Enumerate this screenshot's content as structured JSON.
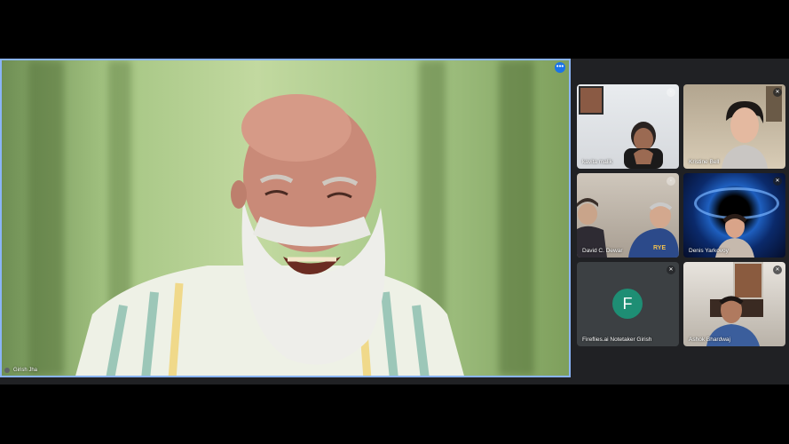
{
  "main_speaker": {
    "name": "Girish Jha",
    "more_icon": "more-options-icon"
  },
  "participants": [
    {
      "name": "kavita malik",
      "muted": false
    },
    {
      "name": "Kristine Bell",
      "muted": true
    },
    {
      "name": "David C. Dewar",
      "muted": false
    },
    {
      "name": "Denis Yarkovoy",
      "muted": true
    },
    {
      "name": "Fireflies.ai Notetaker Girish",
      "muted": true,
      "avatar_letter": "F",
      "avatar_color": "#1e8e74"
    },
    {
      "name": "Ashok Bhardwaj",
      "muted": true
    }
  ],
  "colors": {
    "meet_bg": "#202124",
    "active_border": "#8ab4f8",
    "tile_bg": "#3c4043"
  }
}
